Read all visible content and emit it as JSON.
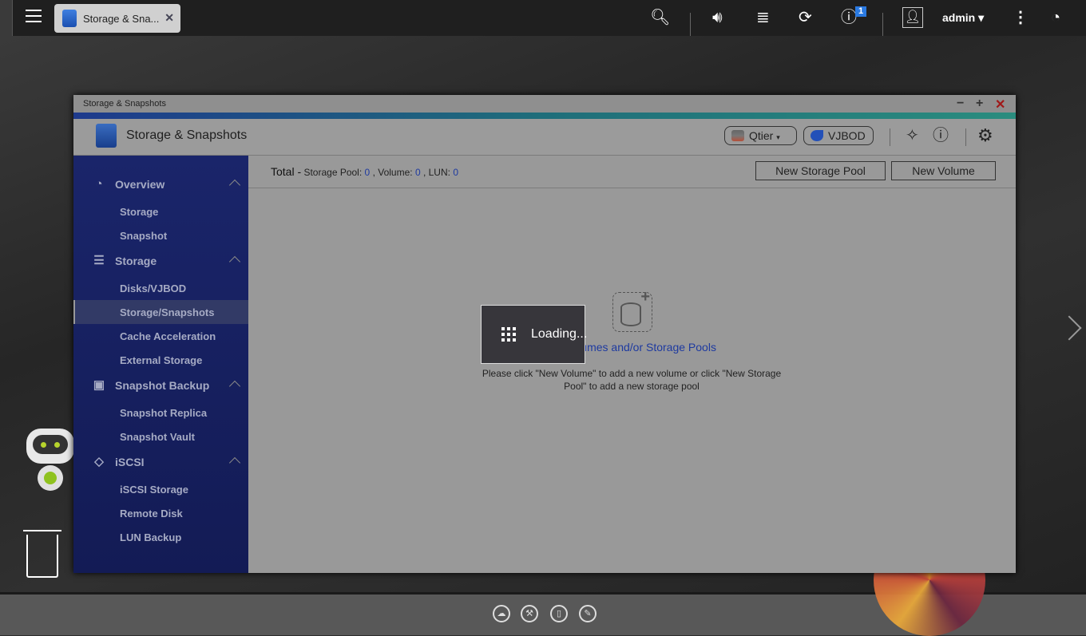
{
  "topbar": {
    "tab_label": "Storage & Sna...",
    "notification_count": "1",
    "user": "admin"
  },
  "window": {
    "title": "Storage & Snapshots",
    "app_title": "Storage & Snapshots",
    "qtier_label": "Qtier",
    "vjbod_label": "VJBOD"
  },
  "sidebar": {
    "groups": [
      {
        "label": "Overview",
        "items": [
          "Storage",
          "Snapshot"
        ]
      },
      {
        "label": "Storage",
        "items": [
          "Disks/VJBOD",
          "Storage/Snapshots",
          "Cache Acceleration",
          "External Storage"
        ]
      },
      {
        "label": "Snapshot Backup",
        "items": [
          "Snapshot Replica",
          "Snapshot Vault"
        ]
      },
      {
        "label": "iSCSI",
        "items": [
          "iSCSI Storage",
          "Remote Disk",
          "LUN Backup"
        ]
      }
    ],
    "selected": "Storage/Snapshots"
  },
  "content": {
    "total_label": "Total -",
    "pool_label": "Storage Pool:",
    "pool_count": "0",
    "volume_label": ", Volume:",
    "volume_count": "0",
    "lun_label": ", LUN:",
    "lun_count": "0",
    "new_pool_button": "New Storage Pool",
    "new_volume_button": "New Volume",
    "empty_title": "No Volumes and/or Storage Pools",
    "empty_desc": "Please click \"New Volume\" to add a new volume or click \"New Storage Pool\" to add a new storage pool"
  },
  "loading": {
    "label": "Loading..."
  }
}
